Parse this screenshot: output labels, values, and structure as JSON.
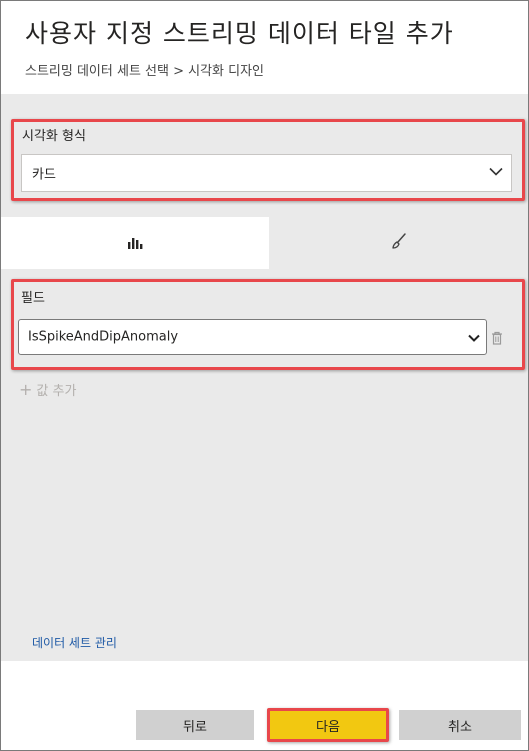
{
  "header": {
    "title": "사용자 지정 스트리밍 데이터 타일 추가",
    "breadcrumb": "스트리밍 데이터 세트 선택 > 시각화 디자인"
  },
  "visualization_type": {
    "label": "시각화 형식",
    "selected": "카드"
  },
  "tabs": [
    {
      "name": "fields",
      "icon": "bar-chart-icon",
      "active": true
    },
    {
      "name": "format",
      "icon": "paintbrush-icon",
      "active": false
    }
  ],
  "fields": {
    "label": "필드",
    "selected": "IsSpikeAndDipAnomaly",
    "add_value_label": "값 추가"
  },
  "manage_dataset_link": "데이터 세트 관리",
  "footer": {
    "back_label": "뒤로",
    "next_label": "다음",
    "cancel_label": "취소"
  },
  "colors": {
    "highlight_red": "#e8474b",
    "primary_button": "#f2c811",
    "panel_gray": "#eaeaea",
    "link_blue": "#1f5aa6"
  }
}
